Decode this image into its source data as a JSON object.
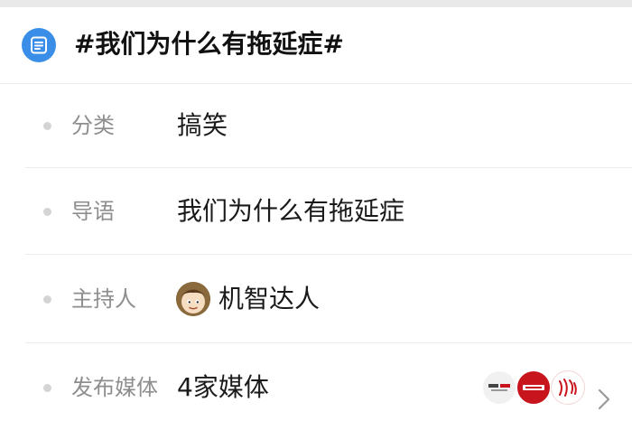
{
  "topic": {
    "title": "#我们为什么有拖延症#",
    "icon": "topic-list-icon",
    "accent_color": "#3a8ee8"
  },
  "rows": [
    {
      "label": "分类",
      "value": "搞笑"
    },
    {
      "label": "导语",
      "value": "我们为什么有拖延症"
    },
    {
      "label": "主持人",
      "value": "机智达人",
      "avatar": "host-avatar"
    },
    {
      "label": "发布媒体",
      "value": "4家媒体",
      "media_logos": [
        "media-logo-1",
        "media-logo-2",
        "media-logo-3"
      ],
      "action_icon": "chevron-right-icon"
    }
  ]
}
